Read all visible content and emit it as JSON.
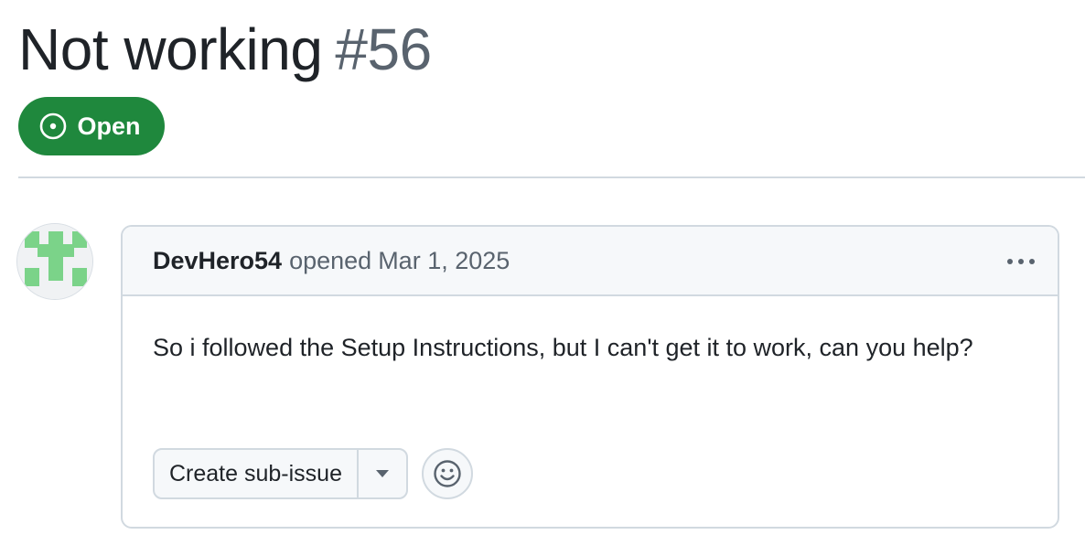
{
  "issue": {
    "title": "Not working",
    "number": "#56",
    "state": "Open",
    "state_color": "#1f883d"
  },
  "comment": {
    "author": "DevHero54",
    "action": "opened",
    "date": "Mar 1, 2025",
    "body": "So i followed the Setup Instructions, but I can't get it to work, can you help?",
    "avatar_color": "#7bd389"
  },
  "actions": {
    "create_sub_issue_label": "Create sub-issue",
    "dropdown_icon": "triangle-down-icon",
    "reaction_icon": "smiley-icon",
    "menu_icon": "kebab-horizontal-icon"
  }
}
